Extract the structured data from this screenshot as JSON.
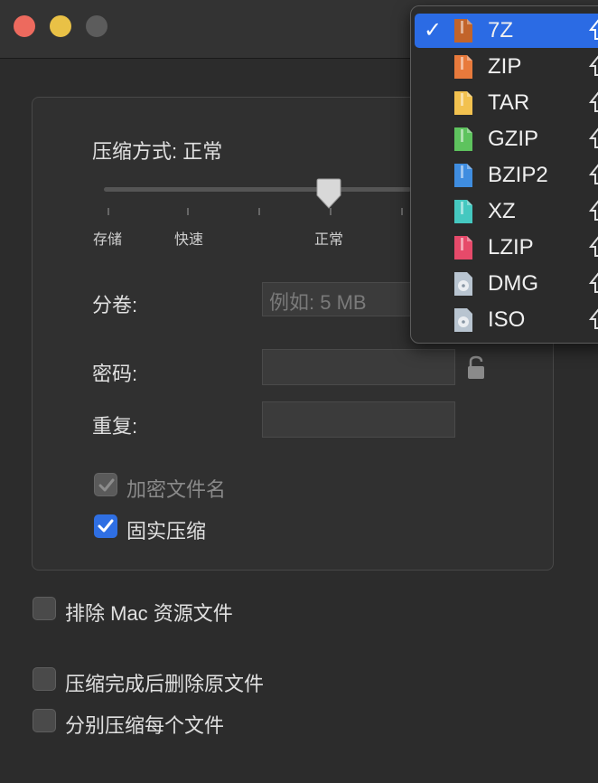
{
  "window": {
    "traffic_lights": [
      "close",
      "minimize",
      "zoom"
    ]
  },
  "compression": {
    "method_label": "压缩方式: 正常",
    "levels": [
      "存储",
      "快速",
      "正常"
    ],
    "selected_level": "正常"
  },
  "split": {
    "label": "分卷:",
    "placeholder": "例如: 5 MB"
  },
  "password": {
    "label": "密码:",
    "repeat_label": "重复:",
    "value": "",
    "repeat_value": ""
  },
  "options": {
    "encrypt_filenames": {
      "label": "加密文件名",
      "checked": true,
      "enabled": false
    },
    "solid": {
      "label": "固实压缩",
      "checked": true,
      "enabled": true
    }
  },
  "bottom_options": [
    {
      "label": "排除 Mac 资源文件",
      "checked": false
    },
    {
      "label": "压缩完成后删除原文件",
      "checked": false
    },
    {
      "label": "分别压缩每个文件",
      "checked": false
    }
  ],
  "format_menu": {
    "selected": "7Z",
    "items": [
      {
        "label": "7Z",
        "color": "#c2642a",
        "kind": "archive"
      },
      {
        "label": "ZIP",
        "color": "#e87a3c",
        "kind": "archive"
      },
      {
        "label": "TAR",
        "color": "#f2c14f",
        "kind": "archive"
      },
      {
        "label": "GZIP",
        "color": "#5ec35e",
        "kind": "archive"
      },
      {
        "label": "BZIP2",
        "color": "#3f8de0",
        "kind": "archive"
      },
      {
        "label": "XZ",
        "color": "#45c8c0",
        "kind": "archive"
      },
      {
        "label": "LZIP",
        "color": "#e64a6a",
        "kind": "archive"
      },
      {
        "label": "DMG",
        "color": "#b8c4d0",
        "kind": "disk"
      },
      {
        "label": "ISO",
        "color": "#b8c4d0",
        "kind": "disk"
      }
    ]
  }
}
